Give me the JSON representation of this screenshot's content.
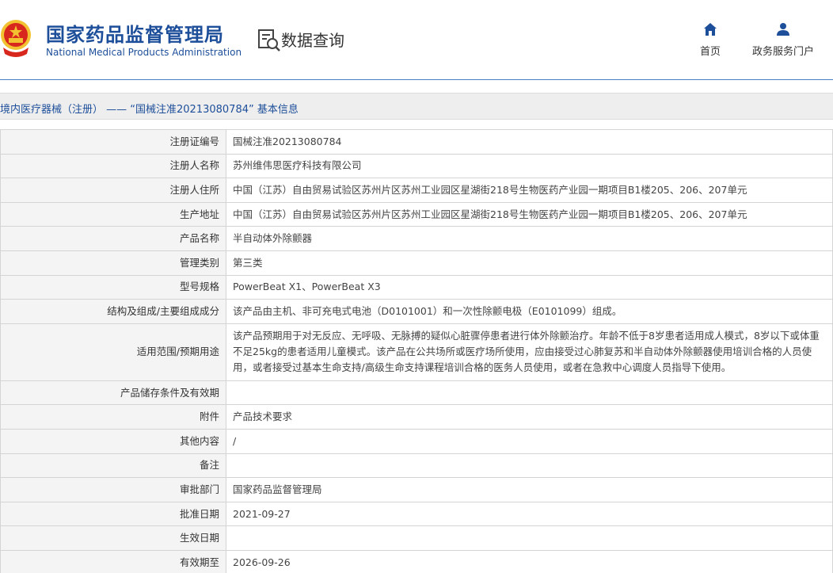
{
  "header": {
    "title_cn": "国家药品监督管理局",
    "title_en": "National Medical Products Administration",
    "section_title": "数据查询",
    "nav": [
      {
        "label": "首页",
        "icon": "home-icon"
      },
      {
        "label": "政务服务门户",
        "icon": "user-icon"
      }
    ]
  },
  "breadcrumb": "境内医疗器械（注册） —— “国械注准20213080784” 基本信息",
  "rows": [
    {
      "label": "注册证编号",
      "value": "国械注准20213080784"
    },
    {
      "label": "注册人名称",
      "value": "苏州维伟思医疗科技有限公司"
    },
    {
      "label": "注册人住所",
      "value": "中国（江苏）自由贸易试验区苏州片区苏州工业园区星湖街218号生物医药产业园一期项目B1楼205、206、207单元"
    },
    {
      "label": "生产地址",
      "value": "中国（江苏）自由贸易试验区苏州片区苏州工业园区星湖街218号生物医药产业园一期项目B1楼205、206、207单元"
    },
    {
      "label": "产品名称",
      "value": "半自动体外除颤器"
    },
    {
      "label": "管理类别",
      "value": "第三类"
    },
    {
      "label": "型号规格",
      "value": "PowerBeat X1、PowerBeat X3"
    },
    {
      "label": "结构及组成/主要组成成分",
      "value": "该产品由主机、非可充电式电池（D0101001）和一次性除颤电极（E0101099）组成。"
    },
    {
      "label": "适用范围/预期用途",
      "value": "该产品预期用于对无反应、无呼吸、无脉搏的疑似心脏骤停患者进行体外除颤治疗。年龄不低于8岁患者适用成人模式，8岁以下或体重不足25kg的患者适用儿童模式。该产品在公共场所或医疗场所使用，应由接受过心肺复苏和半自动体外除颤器使用培训合格的人员使用，或者接受过基本生命支持/高级生命支持课程培训合格的医务人员使用，或者在急救中心调度人员指导下使用。"
    },
    {
      "label": "产品储存条件及有效期",
      "value": ""
    },
    {
      "label": "附件",
      "value": "产品技术要求"
    },
    {
      "label": "其他内容",
      "value": "/"
    },
    {
      "label": "备注",
      "value": ""
    },
    {
      "label": "审批部门",
      "value": "国家药品监督管理局"
    },
    {
      "label": "批准日期",
      "value": "2021-09-27"
    },
    {
      "label": "生效日期",
      "value": ""
    },
    {
      "label": "有效期至",
      "value": "2026-09-26"
    }
  ],
  "colors": {
    "brand": "#1d4e9a",
    "emblem_red": "#d8271c",
    "emblem_gold": "#f2c230"
  }
}
